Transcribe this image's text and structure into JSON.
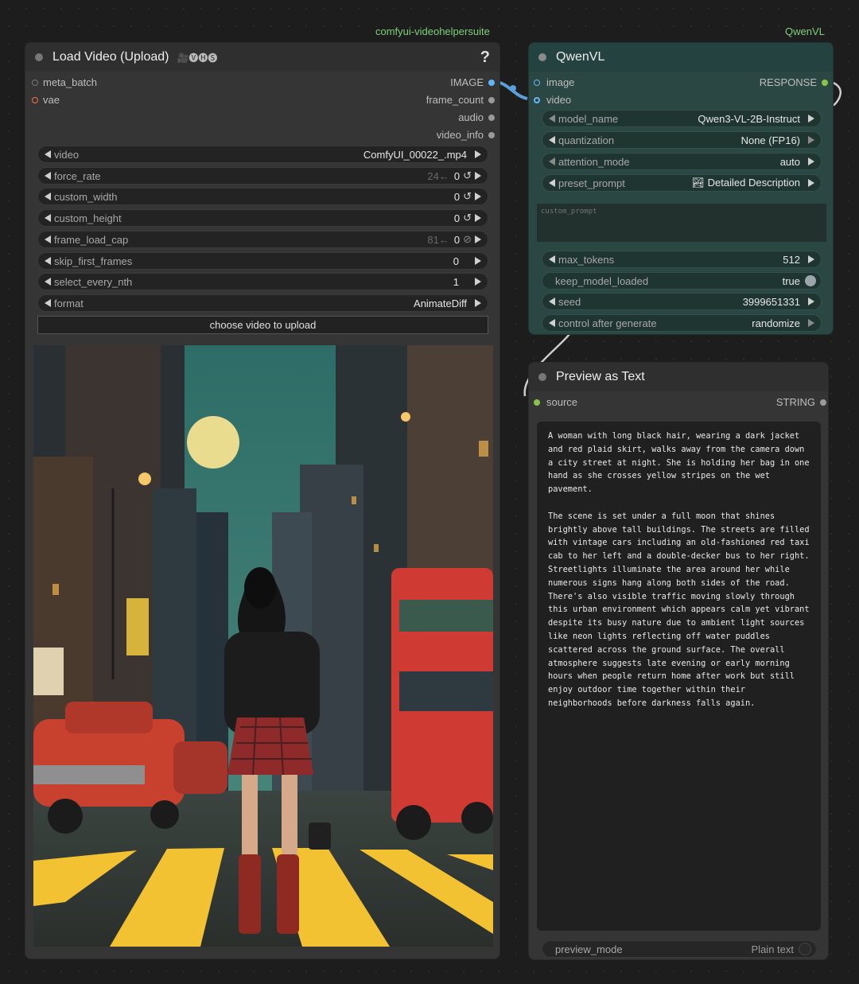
{
  "packs": {
    "left": "comfyui-videohelpersuite",
    "right": "QwenVL"
  },
  "load_video": {
    "title": "Load Video (Upload)",
    "badge_glyphs": "🎥🅥🅗🅢",
    "help": "?",
    "inputs": [
      "meta_batch",
      "vae"
    ],
    "outputs": [
      "IMAGE",
      "frame_count",
      "audio",
      "video_info"
    ],
    "widgets": [
      {
        "name": "video",
        "value": "ComfyUI_00022_.mp4",
        "hint": "",
        "suffix": ""
      },
      {
        "name": "force_rate",
        "value": "0",
        "hint": "24←",
        "suffix": "↺"
      },
      {
        "name": "custom_width",
        "value": "0",
        "hint": "",
        "suffix": "↺"
      },
      {
        "name": "custom_height",
        "value": "0",
        "hint": "",
        "suffix": "↺"
      },
      {
        "name": "frame_load_cap",
        "value": "0",
        "hint": "81←",
        "suffix": "⊘"
      },
      {
        "name": "skip_first_frames",
        "value": "0",
        "hint": "",
        "suffix": ""
      },
      {
        "name": "select_every_nth",
        "value": "1",
        "hint": "",
        "suffix": ""
      },
      {
        "name": "format",
        "value": "AnimateDiff",
        "hint": "",
        "suffix": ""
      }
    ],
    "upload_button": "choose video to upload"
  },
  "qwenvl": {
    "title": "QwenVL",
    "inputs": [
      "image",
      "video"
    ],
    "outputs": [
      "RESPONSE"
    ],
    "widgets": [
      {
        "name": "model_name",
        "value": "Qwen3-VL-2B-Instruct"
      },
      {
        "name": "quantization",
        "value": "None (FP16)"
      },
      {
        "name": "attention_mode",
        "value": "auto"
      },
      {
        "name": "preset_prompt",
        "value": "🏞 Detailed Description"
      }
    ],
    "custom_prompt_placeholder": "custom_prompt",
    "widgets2": [
      {
        "name": "max_tokens",
        "value": "512"
      },
      {
        "name": "keep_model_loaded",
        "value": "true"
      },
      {
        "name": "seed",
        "value": "3999651331"
      },
      {
        "name": "control after generate",
        "value": "randomize"
      }
    ]
  },
  "preview": {
    "title": "Preview as Text",
    "input": "source",
    "output": "STRING",
    "text": "A woman with long black hair, wearing a dark jacket and red plaid skirt, walks away from the camera down a city street at night. She is holding her bag in one hand as she crosses yellow stripes on the wet pavement.\n\nThe scene is set under a full moon that shines brightly above tall buildings. The streets are filled with vintage cars including an old-fashioned red taxi cab to her left and a double-decker bus to her right. Streetlights illuminate the area around her while numerous signs hang along both sides of the road. There's also visible traffic moving slowly through this urban environment which appears calm yet vibrant despite its busy nature due to ambient light sources like neon lights reflecting off water puddles scattered across the ground surface. The overall atmosphere suggests late evening or early morning hours when people return home after work but still enjoy outdoor time together within their neighborhoods before darkness falls again.",
    "mode_name": "preview_mode",
    "mode_value": "Plain text"
  },
  "colors": {
    "image_slot": "#64b5f6",
    "string_slot": "#8bc34a",
    "vae_slot": "#ff7043",
    "node_bg": "#353535",
    "qwen_bg": "#2a4743",
    "link": "#5a9fd8"
  }
}
